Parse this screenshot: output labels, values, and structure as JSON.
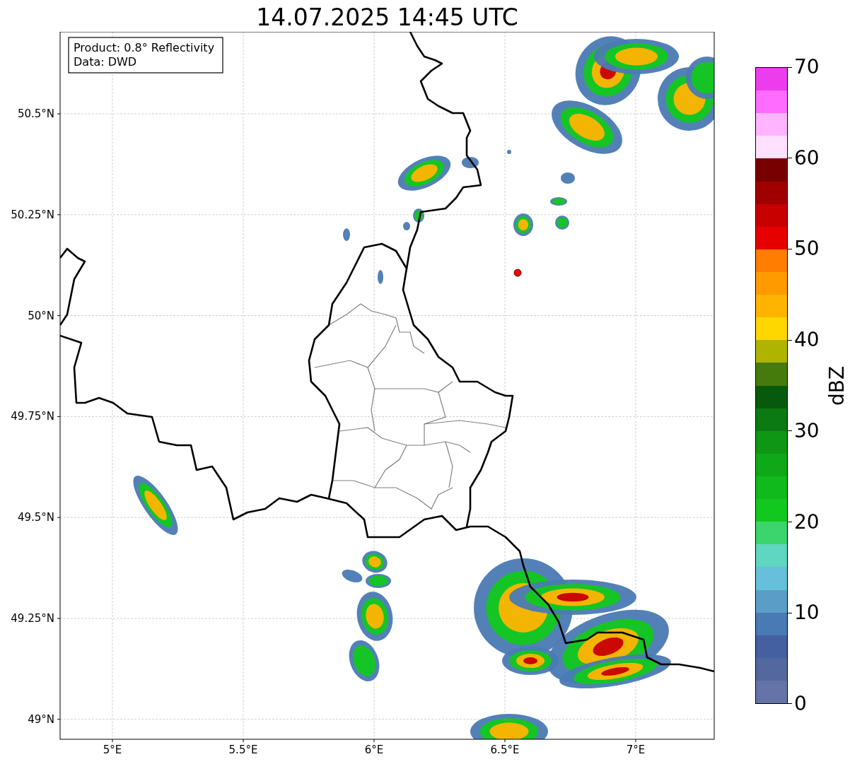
{
  "title": "14.07.2025 14:45 UTC",
  "info_box": [
    "Product: 0.8° Reflectivity",
    "Data: DWD"
  ],
  "map": {
    "x_ticks": [
      "5°E",
      "5.5°E",
      "6°E",
      "6.5°E",
      "7°E"
    ],
    "y_ticks": [
      "50.5°N",
      "50.25°N",
      "50°N",
      "49.75°N",
      "49.5°N",
      "49.25°N",
      "49°N"
    ]
  },
  "colorbar": {
    "label": "dBZ",
    "ticks": [
      "70",
      "60",
      "50",
      "40",
      "30",
      "20",
      "10",
      "0"
    ],
    "bands": [
      {
        "color": "#ec3cec"
      },
      {
        "color": "#ff6cff"
      },
      {
        "color": "#ffb4ff"
      },
      {
        "color": "#ffe0ff"
      },
      {
        "color": "#780000"
      },
      {
        "color": "#a00000"
      },
      {
        "color": "#c80000"
      },
      {
        "color": "#e60000"
      },
      {
        "color": "#ff7d00"
      },
      {
        "color": "#ff9b00"
      },
      {
        "color": "#ffb400"
      },
      {
        "color": "#ffd700"
      },
      {
        "color": "#afb400"
      },
      {
        "color": "#457a0c"
      },
      {
        "color": "#075a0c"
      },
      {
        "color": "#0b7a12"
      },
      {
        "color": "#0e9614"
      },
      {
        "color": "#0fa818"
      },
      {
        "color": "#10b91c"
      },
      {
        "color": "#12c81e"
      },
      {
        "color": "#3cd46c"
      },
      {
        "color": "#5fd6c0"
      },
      {
        "color": "#66c0dc"
      },
      {
        "color": "#5a9ec8"
      },
      {
        "color": "#4a7ab3"
      },
      {
        "color": "#4460a0"
      },
      {
        "color": "#5468a0"
      },
      {
        "color": "#6474a8"
      }
    ]
  }
}
